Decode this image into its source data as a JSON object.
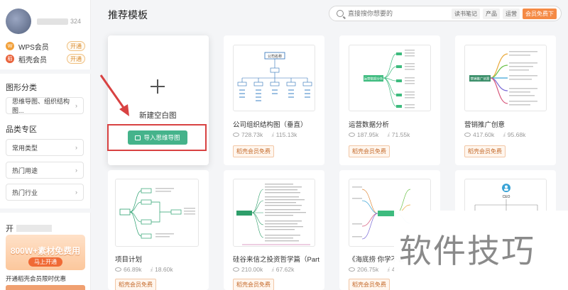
{
  "profile": {
    "username_suffix": "324"
  },
  "memberships": [
    {
      "name": "WPS会员",
      "action": "开通"
    },
    {
      "name": "稻壳会员",
      "action": "开通"
    }
  ],
  "sidebar": {
    "graphic_category_title": "图形分类",
    "graphic_category_value": "思维导图、组织结构图...",
    "special_title": "品类专区",
    "selects": [
      "常用类型",
      "热门用途",
      "热门行业"
    ],
    "promo_title_prefix": "开",
    "promo_headline": "800W+素材免费用",
    "promo_button": "马上开通",
    "promo_footer": "开通稻壳会员限时优惠"
  },
  "header": {
    "title": "推荐模板",
    "search_placeholder": "直接搜你想要的",
    "tags": [
      "读书笔记",
      "产品",
      "运营"
    ],
    "vip_button": "会员免费下"
  },
  "new_card": {
    "label": "新建空白图",
    "import_label": "导入思维导图"
  },
  "templates": [
    {
      "title": "公司组织结构图（垂直）",
      "views": "728.73k",
      "downloads": "115.13k",
      "badge": "稻壳会员免费"
    },
    {
      "title": "运营数据分析",
      "views": "187.95k",
      "downloads": "71.55k",
      "badge": "稻壳会员免费"
    },
    {
      "title": "营销推广创意",
      "views": "417.60k",
      "downloads": "95.68k",
      "badge": "稻壳会员免费"
    },
    {
      "title": "项目计划",
      "views": "66.89k",
      "downloads": "18.60k",
      "badge": "稻壳会员免费"
    },
    {
      "title": "硅谷来信之投资哲学篇（Part",
      "views": "210.00k",
      "downloads": "67.62k",
      "badge": "稻壳会员免费"
    },
    {
      "title": "《海底捞 你学不会",
      "views": "206.75k",
      "downloads": "42",
      "badge": "稻壳会员免费"
    },
    {
      "title": "",
      "views": "",
      "downloads": "",
      "badge": ""
    }
  ],
  "thumb_labels": {
    "org_root": "公司名称",
    "data_center": "运营数据分析",
    "marketing_center": "营销推广创意",
    "ceo": "CEO"
  },
  "watermark": "软件技巧",
  "colors": {
    "accent_green": "#45b38b",
    "highlight_red": "#d84242",
    "vip_orange": "#f58a45"
  }
}
